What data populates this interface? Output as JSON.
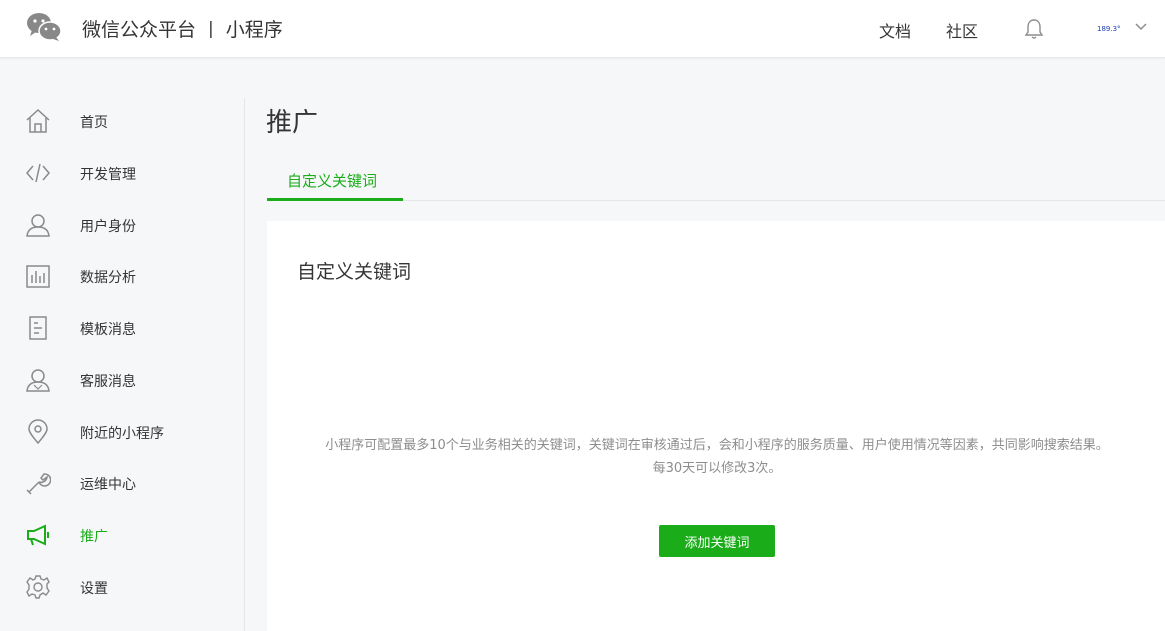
{
  "header": {
    "brand_name": "微信公众平台",
    "separator": "|",
    "product_name": "小程序",
    "links": [
      "文档",
      "社区"
    ],
    "account_label": "189.3°",
    "icons": {
      "logo": "wechat-logo",
      "notifications": "bell-icon",
      "menu": "chevron-down-icon"
    }
  },
  "sidebar": {
    "items": [
      {
        "label": "首页",
        "icon": "home-icon"
      },
      {
        "label": "开发管理",
        "icon": "code-icon"
      },
      {
        "label": "用户身份",
        "icon": "user-icon"
      },
      {
        "label": "数据分析",
        "icon": "chart-icon"
      },
      {
        "label": "模板消息",
        "icon": "document-icon"
      },
      {
        "label": "客服消息",
        "icon": "customer-service-icon"
      },
      {
        "label": "附近的小程序",
        "icon": "location-icon"
      },
      {
        "label": "运维中心",
        "icon": "wrench-icon"
      },
      {
        "label": "推广",
        "icon": "megaphone-icon",
        "active": true
      },
      {
        "label": "设置",
        "icon": "gear-icon"
      }
    ]
  },
  "main": {
    "title": "推广",
    "tabs": [
      {
        "label": "自定义关键词",
        "active": true
      }
    ],
    "card": {
      "title": "自定义关键词",
      "description": "小程序可配置最多10个与业务相关的关键词，关键词在审核通过后，会和小程序的服务质量、用户使用情况等因素，共同影响搜索结果。",
      "note": "每30天可以修改3次。",
      "button_label": "添加关键词"
    }
  },
  "colors": {
    "accent": "#1aad19",
    "text": "#353535",
    "muted": "#8d8d8d",
    "background": "#f6f7f9"
  }
}
